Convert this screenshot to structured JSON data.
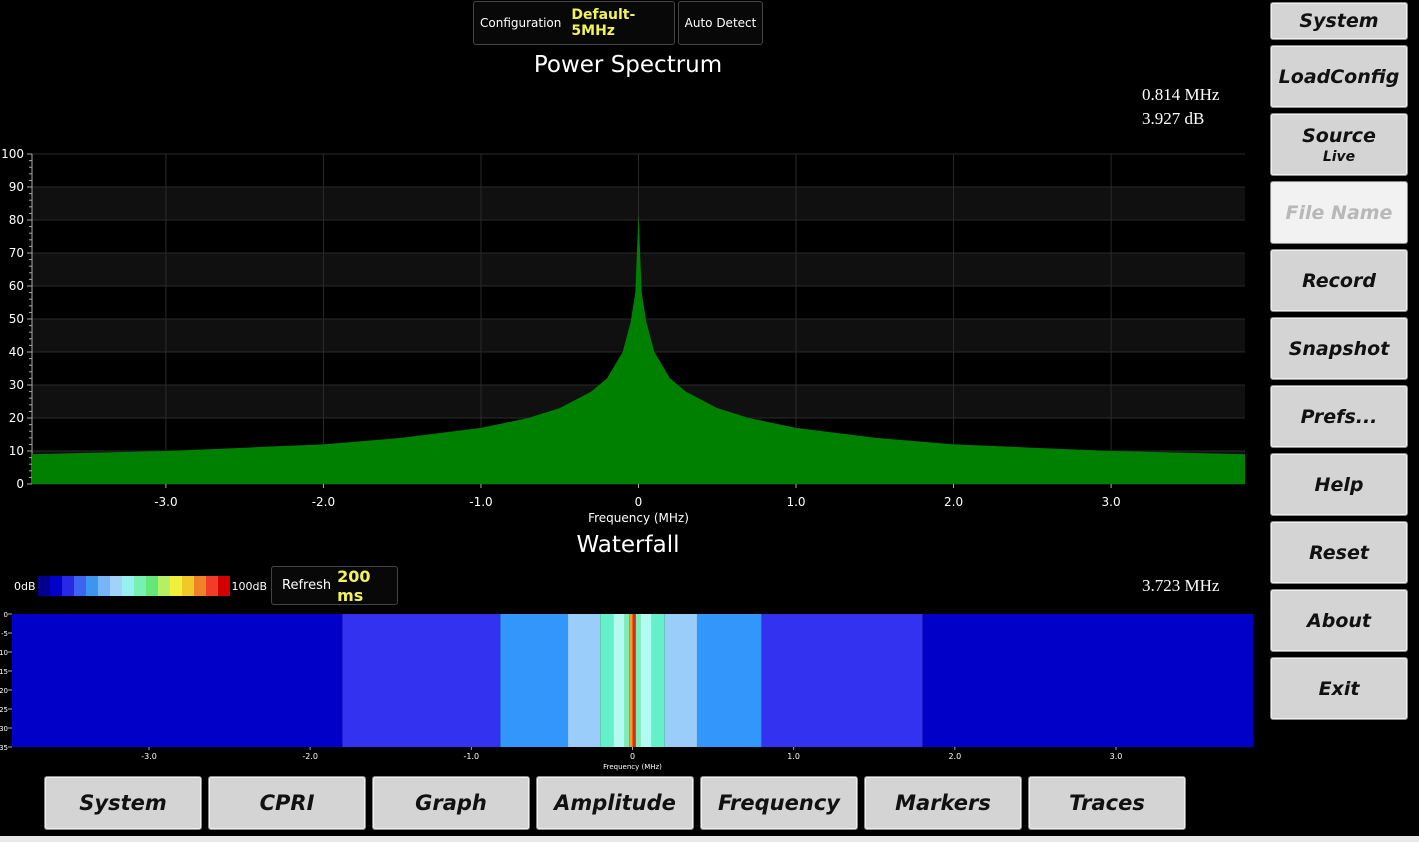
{
  "config_bar": {
    "configuration_label": "Configuration",
    "configuration_value": "Default-5MHz",
    "auto_detect_label": "Auto Detect"
  },
  "power_spectrum": {
    "title": "Power Spectrum",
    "marker_freq": "0.814 MHz",
    "marker_level": "3.927 dB",
    "fill_color": "#008000"
  },
  "waterfall": {
    "title": "Waterfall",
    "legend_min": "0dB",
    "legend_max": "100dB",
    "legend_colors": [
      "#00008c",
      "#0000c8",
      "#2828e8",
      "#3c64f0",
      "#3c96f0",
      "#78b4f8",
      "#a0d2fa",
      "#96f0f0",
      "#78f0b4",
      "#64e678",
      "#b4f064",
      "#f0f03c",
      "#f0c828",
      "#f08228",
      "#f03c28",
      "#d20000"
    ],
    "refresh_label": "Refresh",
    "refresh_value": "200 ms",
    "marker_freq": "3.723 MHz",
    "x_axis_label": "Frequency (MHz)"
  },
  "chart_data": [
    {
      "type": "area",
      "title": "Power Spectrum",
      "xlabel": "Frequency (MHz)",
      "ylabel": "",
      "xlim": [
        -3.85,
        3.85
      ],
      "ylim": [
        0,
        100
      ],
      "x_ticks": [
        "-3.0",
        "-2.0",
        "-1.0",
        "0",
        "1.0",
        "2.0",
        "3.0"
      ],
      "y_ticks": [
        "0",
        "10",
        "20",
        "30",
        "40",
        "50",
        "60",
        "70",
        "80",
        "90",
        "100"
      ],
      "grid": true,
      "series": [
        {
          "x": [
            -3.85,
            -3.0,
            -2.5,
            -2.0,
            -1.5,
            -1.0,
            -0.7,
            -0.5,
            -0.3,
            -0.2,
            -0.1,
            -0.05,
            -0.02,
            0,
            0.02,
            0.05,
            0.1,
            0.2,
            0.3,
            0.5,
            0.7,
            1.0,
            1.5,
            2.0,
            2.5,
            3.0,
            3.85
          ],
          "values": [
            9,
            10,
            11,
            12,
            14,
            17,
            20,
            23,
            28,
            32,
            40,
            49,
            58,
            82,
            58,
            49,
            40,
            32,
            28,
            23,
            20,
            17,
            14,
            12,
            11,
            10,
            9
          ]
        }
      ]
    },
    {
      "type": "heatmap",
      "title": "Waterfall",
      "xlabel": "Frequency (MHz)",
      "xlim": [
        -3.85,
        3.85
      ],
      "x_ticks": [
        "-3.0",
        "-2.0",
        "-1.0",
        "0",
        "1.0",
        "2.0",
        "3.0"
      ],
      "y_ticks": [
        "0",
        "5",
        "10",
        "15",
        "20",
        "25",
        "30",
        "35"
      ],
      "bands": [
        {
          "from": -3.85,
          "to": -1.8,
          "color": "#0000c8"
        },
        {
          "from": -1.8,
          "to": -0.82,
          "color": "#3232f0"
        },
        {
          "from": -0.82,
          "to": -0.4,
          "color": "#3296fa"
        },
        {
          "from": -0.4,
          "to": -0.2,
          "color": "#9bcdfa"
        },
        {
          "from": -0.2,
          "to": -0.12,
          "color": "#64f0c8"
        },
        {
          "from": -0.12,
          "to": -0.05,
          "color": "#b4faf0"
        },
        {
          "from": -0.05,
          "to": -0.02,
          "color": "#78f0b4"
        },
        {
          "from": -0.02,
          "to": 0.0,
          "color": "#f0a028"
        },
        {
          "from": 0.0,
          "to": 0.02,
          "color": "#e02818"
        },
        {
          "from": 0.02,
          "to": 0.05,
          "color": "#78f0b4"
        },
        {
          "from": 0.05,
          "to": 0.12,
          "color": "#b4faf0"
        },
        {
          "from": 0.12,
          "to": 0.2,
          "color": "#64f0c8"
        },
        {
          "from": 0.2,
          "to": 0.4,
          "color": "#9bcdfa"
        },
        {
          "from": 0.4,
          "to": 0.8,
          "color": "#3296fa"
        },
        {
          "from": 0.8,
          "to": 1.8,
          "color": "#3232f0"
        },
        {
          "from": 1.8,
          "to": 3.85,
          "color": "#0000c8"
        }
      ]
    }
  ],
  "side_menu": [
    {
      "label": "System",
      "sub": ""
    },
    {
      "label": "LoadConfig",
      "sub": ""
    },
    {
      "label": "Source",
      "sub": "Live"
    },
    {
      "label": "File Name",
      "sub": ""
    },
    {
      "label": "Record",
      "sub": ""
    },
    {
      "label": "Snapshot",
      "sub": ""
    },
    {
      "label": "Prefs...",
      "sub": ""
    },
    {
      "label": "Help",
      "sub": ""
    },
    {
      "label": "Reset",
      "sub": ""
    },
    {
      "label": "About",
      "sub": ""
    },
    {
      "label": "Exit",
      "sub": ""
    }
  ],
  "bottom_menu": [
    "System",
    "CPRI",
    "Graph",
    "Amplitude",
    "Frequency",
    "Markers",
    "Traces"
  ]
}
